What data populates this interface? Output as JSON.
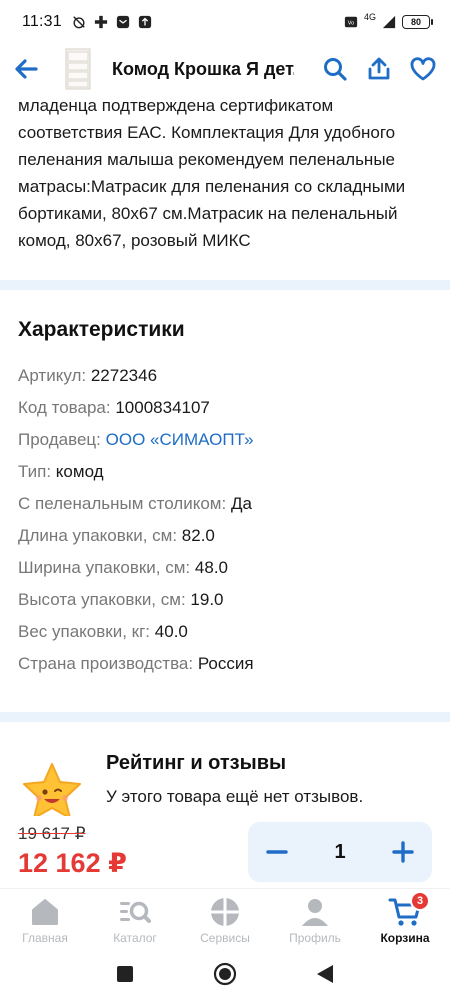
{
  "status_bar": {
    "time": "11:31",
    "network": "4G",
    "battery": "80"
  },
  "header": {
    "title": "Комод Крошка Я дет...",
    "icons": [
      "back-arrow-icon",
      "search-icon",
      "share-icon",
      "heart-icon"
    ]
  },
  "description": {
    "lines": [
      "младенца подтверждена сертификатом",
      "соответствия ЕАС. Комплектация Для удобного",
      "пеленания малыша рекомендуем пеленальные",
      "матрасы:Матрасик для пеленания со складными",
      "бортиками, 80х67 см.Матрасик на пеленальный",
      "комод, 80х67, розовый МИКС"
    ]
  },
  "characteristics": {
    "title": "Характеристики",
    "rows": [
      {
        "label": "Артикул:",
        "value": "2272346"
      },
      {
        "label": "Код товара:",
        "value": "1000834107"
      },
      {
        "label": "Продавец:",
        "value": "ООО «СИМАОПТ»"
      },
      {
        "label": "Тип:",
        "value": "комод"
      },
      {
        "label": "С пеленальным столиком:",
        "value": "Да"
      },
      {
        "label": "Длина упаковки, см:",
        "value": "82.0"
      },
      {
        "label": "Ширина упаковки, см:",
        "value": "48.0"
      },
      {
        "label": "Высота упаковки, см:",
        "value": "19.0"
      },
      {
        "label": "Вес упаковки, кг:",
        "value": "40.0"
      },
      {
        "label": "Страна производства:",
        "value": "Россия"
      }
    ]
  },
  "rating": {
    "title": "Рейтинг и отзывы",
    "subtitle": "У этого товара ещё нет отзывов."
  },
  "purchase": {
    "old_price": "19 617 ₽",
    "new_price": "12 162 ₽",
    "quantity": "1"
  },
  "bottom_nav": {
    "items": [
      {
        "label": "Главная",
        "icon": "home-icon"
      },
      {
        "label": "Каталог",
        "icon": "catalog-search-icon"
      },
      {
        "label": "Сервисы",
        "icon": "services-icon"
      },
      {
        "label": "Профиль",
        "icon": "profile-icon"
      },
      {
        "label": "Корзина",
        "icon": "cart-icon"
      }
    ],
    "cart_badge": "3",
    "active_index": 4
  },
  "colors": {
    "accent": "#1f6dc6",
    "price_red": "#e53935",
    "band": "#eaf3fb",
    "inactive": "#b5b9be"
  }
}
